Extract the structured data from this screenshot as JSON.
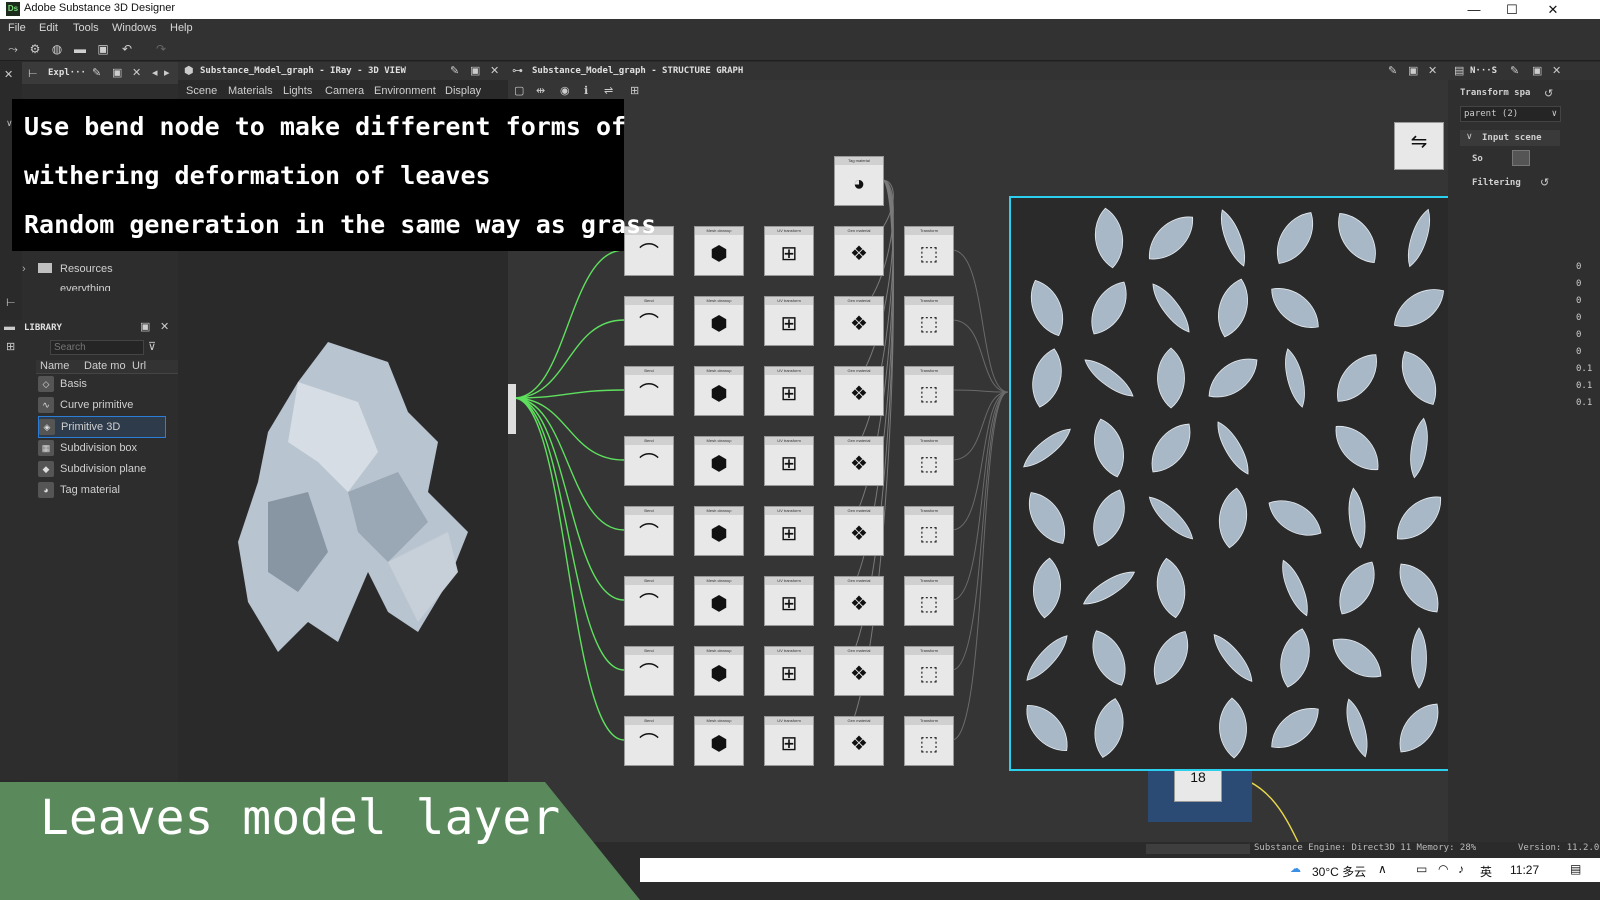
{
  "window": {
    "app_icon": "Ds",
    "title": "Adobe Substance 3D Designer",
    "minimize": "—",
    "maximize": "☐",
    "close": "✕"
  },
  "menu": [
    "File",
    "Edit",
    "Tools",
    "Windows",
    "Help"
  ],
  "explorer": {
    "tab_title": "Expl···",
    "items": [
      "Resources",
      "everything"
    ]
  },
  "library": {
    "tab_title": "LIBRARY",
    "search_placeholder": "Search",
    "columns": [
      "Name",
      "Date mo",
      "Url"
    ],
    "items": [
      {
        "label": "Basis",
        "icon": "basis-icon"
      },
      {
        "label": "Curve primitive",
        "icon": "curve-icon"
      },
      {
        "label": "Primitive 3D",
        "icon": "primitive-icon"
      },
      {
        "label": "Subdivision box",
        "icon": "box-icon"
      },
      {
        "label": "Subdivision plane",
        "icon": "plane-icon"
      },
      {
        "label": "Tag material",
        "icon": "tag-icon"
      }
    ],
    "selected_index": 2
  },
  "view3d": {
    "tab_title": "Substance_Model_graph - IRay - 3D VIEW",
    "menu": [
      "Scene",
      "Materials",
      "Lights",
      "Camera",
      "Environment",
      "Display"
    ]
  },
  "graph": {
    "tab_title": "Substance_Model_graph - STRUCTURE GRAPH",
    "top_node_label": "Tag material",
    "column_labels": [
      "Bend",
      "Mesh cleanup",
      "UV transform",
      "Gen material",
      "Transform"
    ],
    "rows": 8,
    "bottom_node_value": "18"
  },
  "caption": {
    "line1": "Use bend node to make different forms of",
    "line2": "withering deformation of leaves",
    "line3": "Random generation in the same way as grass"
  },
  "banner": {
    "text": "Leaves model layer",
    "color": "#5a8a5c"
  },
  "right_panel": {
    "tab_title": "N···S",
    "transform_space_label": "Transform spa",
    "transform_space_value": "parent (2)",
    "input_scene_label": "Input scene",
    "so_label": "So",
    "filtering_label": "Filtering",
    "values": [
      "0",
      "0",
      "0",
      "0",
      "0",
      "0",
      "0.1",
      "0.1",
      "0.1"
    ]
  },
  "status": {
    "engine": "Substance Engine: Direct3D 11 Memory: 28%",
    "version": "Version: 11.2.0"
  },
  "taskbar": {
    "weather": "30°C 多云",
    "lang": "英",
    "time": "11:27"
  },
  "colors": {
    "highlight": "#2bd0ef",
    "wire_green": "#5ee05e",
    "wire_yellow": "#e8d84a"
  }
}
